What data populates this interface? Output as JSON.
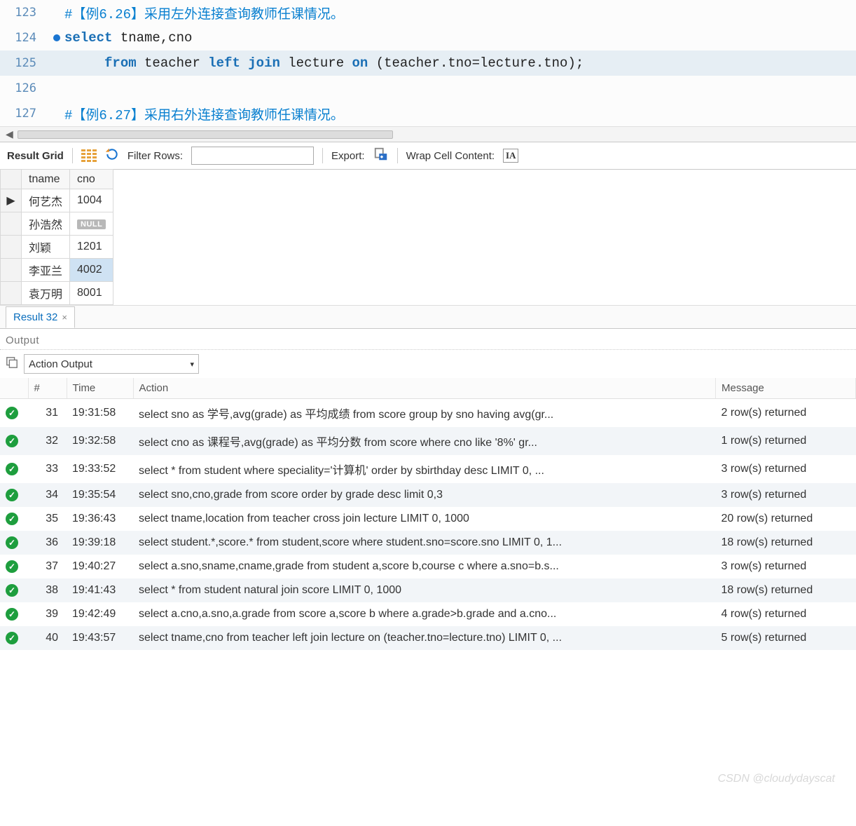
{
  "editor": {
    "lines": [
      {
        "num": "123",
        "bp": false,
        "active": false,
        "segments": [
          {
            "cls": "tok-comment",
            "text": "#【例6.26】采用左外连接查询教师任课情况。"
          }
        ]
      },
      {
        "num": "124",
        "bp": true,
        "active": false,
        "segments": [
          {
            "cls": "tok-kw",
            "text": "select "
          },
          {
            "cls": "tok-id",
            "text": "tname"
          },
          {
            "cls": "tok-punc",
            "text": ","
          },
          {
            "cls": "tok-id",
            "text": "cno"
          }
        ]
      },
      {
        "num": "125",
        "bp": false,
        "active": true,
        "indent": "     ",
        "segments": [
          {
            "cls": "tok-kw",
            "text": "from "
          },
          {
            "cls": "tok-id",
            "text": "teacher "
          },
          {
            "cls": "tok-kw",
            "text": "left join "
          },
          {
            "cls": "tok-id",
            "text": "lecture "
          },
          {
            "cls": "tok-kw",
            "text": "on "
          },
          {
            "cls": "tok-punc",
            "text": "("
          },
          {
            "cls": "tok-id",
            "text": "teacher"
          },
          {
            "cls": "tok-punc",
            "text": "."
          },
          {
            "cls": "tok-id",
            "text": "tno"
          },
          {
            "cls": "tok-punc",
            "text": "="
          },
          {
            "cls": "tok-id",
            "text": "lecture"
          },
          {
            "cls": "tok-punc",
            "text": "."
          },
          {
            "cls": "tok-id",
            "text": "tno"
          },
          {
            "cls": "tok-punc",
            "text": ");"
          }
        ]
      },
      {
        "num": "126",
        "bp": false,
        "active": false,
        "segments": []
      },
      {
        "num": "127",
        "bp": false,
        "active": false,
        "segments": [
          {
            "cls": "tok-comment",
            "text": "#【例6.27】采用右外连接查询教师任课情况。"
          }
        ]
      }
    ]
  },
  "toolbar": {
    "result_grid": "Result Grid",
    "filter_rows": "Filter Rows:",
    "export": "Export:",
    "wrap": "Wrap Cell Content:",
    "wrap_icon": "IA"
  },
  "grid": {
    "columns": [
      "tname",
      "cno"
    ],
    "null_label": "NULL",
    "rows": [
      {
        "marker": "▶",
        "tname": "何艺杰",
        "cno": "1004",
        "sel": false
      },
      {
        "marker": "",
        "tname": "孙浩然",
        "cno": null,
        "sel": false
      },
      {
        "marker": "",
        "tname": "刘颖",
        "cno": "1201",
        "sel": false
      },
      {
        "marker": "",
        "tname": "李亚兰",
        "cno": "4002",
        "sel": true
      },
      {
        "marker": "",
        "tname": "袁万明",
        "cno": "8001",
        "sel": false
      }
    ]
  },
  "tab": {
    "label": "Result 32",
    "close": "×"
  },
  "output": {
    "title": "Output",
    "dropdown": "Action Output",
    "headers": {
      "num": "#",
      "time": "Time",
      "action": "Action",
      "message": "Message"
    },
    "rows": [
      {
        "n": "31",
        "t": "19:31:58",
        "a": "select sno as 学号,avg(grade) as 平均成绩 from score group by sno having avg(gr...",
        "m": "2 row(s) returned"
      },
      {
        "n": "32",
        "t": "19:32:58",
        "a": "select cno as 课程号,avg(grade) as 平均分数 from score where cno like '8%'    gr...",
        "m": "1 row(s) returned"
      },
      {
        "n": "33",
        "t": "19:33:52",
        "a": "select * from student where speciality='计算机'    order by sbirthday desc LIMIT 0, ...",
        "m": "3 row(s) returned"
      },
      {
        "n": "34",
        "t": "19:35:54",
        "a": "select sno,cno,grade from score order by grade desc    limit 0,3",
        "m": "3 row(s) returned"
      },
      {
        "n": "35",
        "t": "19:36:43",
        "a": "select tname,location from teacher cross join lecture LIMIT 0, 1000",
        "m": "20 row(s) returned"
      },
      {
        "n": "36",
        "t": "19:39:18",
        "a": "select student.*,score.* from student,score where student.sno=score.sno LIMIT 0, 1...",
        "m": "18 row(s) returned"
      },
      {
        "n": "37",
        "t": "19:40:27",
        "a": "select a.sno,sname,cname,grade from student a,score b,course c where a.sno=b.s...",
        "m": "3 row(s) returned"
      },
      {
        "n": "38",
        "t": "19:41:43",
        "a": "select * from student natural join score LIMIT 0, 1000",
        "m": "18 row(s) returned"
      },
      {
        "n": "39",
        "t": "19:42:49",
        "a": "select a.cno,a.sno,a.grade from score a,score b where a.grade>b.grade and a.cno...",
        "m": "4 row(s) returned"
      },
      {
        "n": "40",
        "t": "19:43:57",
        "a": "select tname,cno from teacher left join lecture on (teacher.tno=lecture.tno) LIMIT 0, ...",
        "m": "5 row(s) returned"
      }
    ]
  },
  "watermark": "CSDN @cloudydayscat"
}
